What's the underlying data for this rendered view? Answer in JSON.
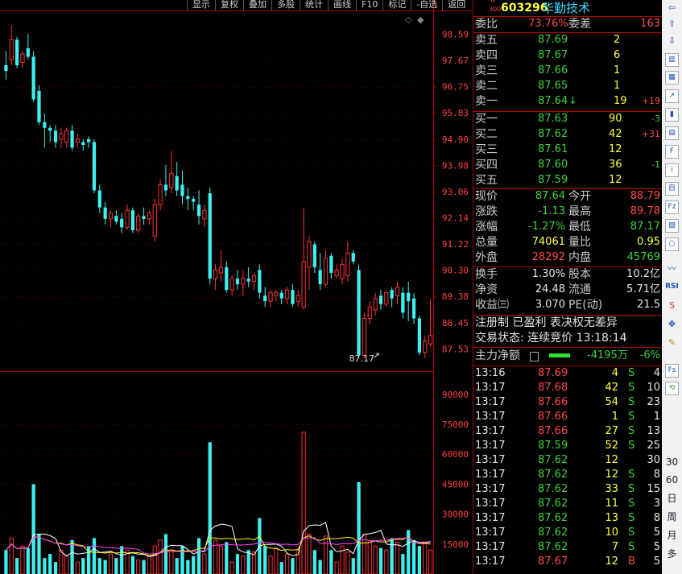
{
  "toolbar": [
    "显示",
    "复权",
    "叠加",
    "多股",
    "统计",
    "画线",
    "F10",
    "标记",
    "-自选",
    "返回"
  ],
  "chart_data": [
    {
      "type": "candlestick",
      "title": "",
      "price_axis": [
        "98.59",
        "97.67",
        "96.75",
        "95.83",
        "94.90",
        "93.98",
        "93.06",
        "92.14",
        "91.22",
        "90.30",
        "89.38",
        "88.45",
        "87.53"
      ],
      "ylim": [
        87.0,
        99.2
      ],
      "low_marker": "87.17",
      "up_color": "#ff3030",
      "down_color": "#3ef0f0",
      "candles": [
        {
          "o": 97.5,
          "h": 98.0,
          "l": 97.0,
          "c": 97.3
        },
        {
          "o": 97.7,
          "h": 98.9,
          "l": 97.5,
          "c": 98.4
        },
        {
          "o": 98.4,
          "h": 98.5,
          "l": 97.4,
          "c": 97.5
        },
        {
          "o": 97.6,
          "h": 98.0,
          "l": 97.4,
          "c": 97.9
        },
        {
          "o": 98.1,
          "h": 98.6,
          "l": 97.7,
          "c": 97.8
        },
        {
          "o": 97.8,
          "h": 98.0,
          "l": 96.2,
          "c": 96.3
        },
        {
          "o": 96.6,
          "h": 96.8,
          "l": 95.4,
          "c": 95.5
        },
        {
          "o": 95.5,
          "h": 95.8,
          "l": 94.6,
          "c": 95.3
        },
        {
          "o": 95.3,
          "h": 95.4,
          "l": 94.8,
          "c": 95.2
        },
        {
          "o": 95.2,
          "h": 95.4,
          "l": 94.6,
          "c": 94.8
        },
        {
          "o": 94.9,
          "h": 95.3,
          "l": 94.6,
          "c": 95.1
        },
        {
          "o": 94.8,
          "h": 95.3,
          "l": 94.6,
          "c": 95.2
        },
        {
          "o": 95.2,
          "h": 95.4,
          "l": 94.5,
          "c": 94.6
        },
        {
          "o": 94.8,
          "h": 95.1,
          "l": 94.6,
          "c": 94.9
        },
        {
          "o": 94.8,
          "h": 94.9,
          "l": 94.5,
          "c": 94.7
        },
        {
          "o": 94.9,
          "h": 95.0,
          "l": 94.6,
          "c": 94.8
        },
        {
          "o": 94.8,
          "h": 94.9,
          "l": 93.0,
          "c": 93.1
        },
        {
          "o": 93.1,
          "h": 93.3,
          "l": 92.3,
          "c": 92.5
        },
        {
          "o": 92.5,
          "h": 92.7,
          "l": 91.9,
          "c": 92.1
        },
        {
          "o": 92.1,
          "h": 92.4,
          "l": 91.8,
          "c": 92.3
        },
        {
          "o": 92.2,
          "h": 92.4,
          "l": 91.9,
          "c": 92.0
        },
        {
          "o": 92.1,
          "h": 92.3,
          "l": 91.6,
          "c": 91.8
        },
        {
          "o": 91.8,
          "h": 92.6,
          "l": 91.7,
          "c": 92.4
        },
        {
          "o": 92.4,
          "h": 92.5,
          "l": 91.6,
          "c": 91.7
        },
        {
          "o": 91.7,
          "h": 92.3,
          "l": 91.6,
          "c": 92.2
        },
        {
          "o": 92.2,
          "h": 92.5,
          "l": 91.9,
          "c": 92.1
        },
        {
          "o": 92.1,
          "h": 92.4,
          "l": 91.9,
          "c": 92.3
        },
        {
          "o": 91.5,
          "h": 92.8,
          "l": 91.3,
          "c": 92.6
        },
        {
          "o": 92.6,
          "h": 93.5,
          "l": 92.4,
          "c": 93.3
        },
        {
          "o": 93.3,
          "h": 94.0,
          "l": 92.9,
          "c": 93.1
        },
        {
          "o": 93.2,
          "h": 94.5,
          "l": 93.0,
          "c": 93.7
        },
        {
          "o": 93.6,
          "h": 94.1,
          "l": 92.9,
          "c": 93.1
        },
        {
          "o": 93.3,
          "h": 93.8,
          "l": 92.6,
          "c": 92.9
        },
        {
          "o": 92.9,
          "h": 93.2,
          "l": 92.4,
          "c": 92.8
        },
        {
          "o": 92.8,
          "h": 92.9,
          "l": 92.4,
          "c": 92.7
        },
        {
          "o": 92.6,
          "h": 93.1,
          "l": 91.9,
          "c": 92.2
        },
        {
          "o": 92.1,
          "h": 92.6,
          "l": 91.8,
          "c": 92.4
        },
        {
          "o": 93.0,
          "h": 93.2,
          "l": 89.8,
          "c": 90.0
        },
        {
          "o": 90.0,
          "h": 90.5,
          "l": 89.6,
          "c": 90.3
        },
        {
          "o": 90.2,
          "h": 91.0,
          "l": 89.9,
          "c": 90.4
        },
        {
          "o": 90.4,
          "h": 90.6,
          "l": 89.5,
          "c": 89.6
        },
        {
          "o": 89.6,
          "h": 90.1,
          "l": 89.4,
          "c": 90.0
        },
        {
          "o": 90.0,
          "h": 90.3,
          "l": 89.6,
          "c": 89.8
        },
        {
          "o": 89.8,
          "h": 90.3,
          "l": 89.4,
          "c": 90.0
        },
        {
          "o": 90.0,
          "h": 90.4,
          "l": 89.7,
          "c": 89.9
        },
        {
          "o": 89.9,
          "h": 90.2,
          "l": 89.6,
          "c": 90.1
        },
        {
          "o": 90.3,
          "h": 90.5,
          "l": 89.3,
          "c": 89.5
        },
        {
          "o": 89.4,
          "h": 89.7,
          "l": 89.0,
          "c": 89.2
        },
        {
          "o": 89.2,
          "h": 89.6,
          "l": 89.0,
          "c": 89.5
        },
        {
          "o": 89.4,
          "h": 89.6,
          "l": 89.2,
          "c": 89.5
        },
        {
          "o": 89.5,
          "h": 89.6,
          "l": 89.1,
          "c": 89.3
        },
        {
          "o": 89.3,
          "h": 89.7,
          "l": 89.1,
          "c": 89.6
        },
        {
          "o": 89.6,
          "h": 89.8,
          "l": 89.0,
          "c": 89.1
        },
        {
          "o": 89.2,
          "h": 89.6,
          "l": 89.0,
          "c": 89.4
        },
        {
          "o": 89.0,
          "h": 92.5,
          "l": 88.9,
          "c": 90.6
        },
        {
          "o": 90.4,
          "h": 91.5,
          "l": 89.6,
          "c": 91.3
        },
        {
          "o": 91.2,
          "h": 91.3,
          "l": 90.2,
          "c": 90.4
        },
        {
          "o": 90.3,
          "h": 90.9,
          "l": 89.6,
          "c": 89.8
        },
        {
          "o": 89.8,
          "h": 91.0,
          "l": 89.7,
          "c": 90.7
        },
        {
          "o": 90.8,
          "h": 90.9,
          "l": 90.0,
          "c": 90.2
        },
        {
          "o": 90.1,
          "h": 90.5,
          "l": 90.0,
          "c": 90.3
        },
        {
          "o": 90.0,
          "h": 90.7,
          "l": 89.8,
          "c": 90.5
        },
        {
          "o": 90.1,
          "h": 91.3,
          "l": 89.9,
          "c": 90.9
        },
        {
          "o": 90.9,
          "h": 91.0,
          "l": 90.5,
          "c": 90.6
        },
        {
          "o": 90.3,
          "h": 90.5,
          "l": 87.2,
          "c": 87.3
        },
        {
          "o": 87.3,
          "h": 88.8,
          "l": 87.2,
          "c": 88.6
        },
        {
          "o": 88.6,
          "h": 89.2,
          "l": 88.4,
          "c": 89.0
        },
        {
          "o": 88.9,
          "h": 89.5,
          "l": 88.7,
          "c": 89.3
        },
        {
          "o": 89.4,
          "h": 89.6,
          "l": 88.9,
          "c": 89.1
        },
        {
          "o": 89.1,
          "h": 89.6,
          "l": 89.0,
          "c": 89.5
        },
        {
          "o": 89.6,
          "h": 89.7,
          "l": 89.0,
          "c": 89.3
        },
        {
          "o": 89.4,
          "h": 89.9,
          "l": 89.1,
          "c": 89.7
        },
        {
          "o": 89.5,
          "h": 89.7,
          "l": 88.6,
          "c": 88.8
        },
        {
          "o": 89.5,
          "h": 89.9,
          "l": 88.5,
          "c": 89.2
        },
        {
          "o": 89.3,
          "h": 89.5,
          "l": 88.4,
          "c": 88.6
        },
        {
          "o": 88.6,
          "h": 88.7,
          "l": 87.3,
          "c": 87.4
        },
        {
          "o": 87.4,
          "h": 88.0,
          "l": 87.2,
          "c": 87.8
        },
        {
          "o": 87.7,
          "h": 89.3,
          "l": 87.6,
          "c": 88.0
        }
      ]
    },
    {
      "type": "bar",
      "title": "volume",
      "volume_axis": [
        "90000",
        "75000",
        "60000",
        "45000",
        "30000",
        "15000"
      ],
      "ylim": [
        0,
        98000
      ],
      "values": [
        12000,
        18000,
        8000,
        14000,
        13000,
        45000,
        20000,
        8000,
        10000,
        6000,
        12000,
        9000,
        17000,
        6000,
        8000,
        14000,
        18000,
        8000,
        7000,
        10000,
        8000,
        14000,
        12000,
        9000,
        7000,
        7000,
        9000,
        14000,
        17000,
        20000,
        12000,
        8000,
        14000,
        7000,
        9000,
        18000,
        10000,
        66000,
        17000,
        14000,
        16000,
        6000,
        10000,
        9000,
        12000,
        11000,
        28000,
        14000,
        9000,
        13000,
        6000,
        10000,
        8000,
        12000,
        71000,
        20000,
        12000,
        7000,
        19000,
        12000,
        6000,
        14000,
        11000,
        8000,
        46000,
        20000,
        16000,
        14000,
        13000,
        12000,
        18000,
        16000,
        10000,
        22000,
        17000,
        14000,
        16000,
        12000
      ],
      "ma_lines": [
        {
          "name": "MA5",
          "color": "#ffffff"
        },
        {
          "name": "MA10",
          "color": "#ffff00"
        },
        {
          "name": "MA20",
          "color": "#ff40ff"
        }
      ]
    }
  ],
  "stock": {
    "board": "R",
    "board_sub": "300",
    "code": "603296",
    "name": "华勤技术"
  },
  "weibi": {
    "label1": "委比",
    "val1": "73.76%",
    "label2": "委差",
    "val2": "163"
  },
  "sell": [
    {
      "label": "卖五",
      "price": "87.69",
      "vol": "2",
      "chg": ""
    },
    {
      "label": "卖四",
      "price": "87.67",
      "vol": "6",
      "chg": ""
    },
    {
      "label": "卖三",
      "price": "87.66",
      "vol": "1",
      "chg": ""
    },
    {
      "label": "卖二",
      "price": "87.65",
      "vol": "1",
      "chg": ""
    },
    {
      "label": "卖一",
      "price": "87.64",
      "arrow": "↓",
      "vol": "19",
      "chg": "+19"
    }
  ],
  "buy": [
    {
      "label": "买一",
      "price": "87.63",
      "vol": "90",
      "chg": "-3"
    },
    {
      "label": "买二",
      "price": "87.62",
      "vol": "42",
      "chg": "+31"
    },
    {
      "label": "买三",
      "price": "87.61",
      "vol": "12",
      "chg": ""
    },
    {
      "label": "买四",
      "price": "87.60",
      "vol": "36",
      "chg": "-1"
    },
    {
      "label": "买五",
      "price": "87.59",
      "vol": "12",
      "chg": ""
    }
  ],
  "quote": [
    {
      "l1": "现价",
      "v1": "87.64",
      "l2": "今开",
      "v2": "88.79"
    },
    {
      "l1": "涨跌",
      "v1": "-1.13",
      "l2": "最高",
      "v2": "89.78"
    },
    {
      "l1": "涨幅",
      "v1": "-1.27%",
      "l2": "最低",
      "v2": "87.17"
    },
    {
      "l1": "总量",
      "v1": "74061",
      "l2": "量比",
      "v2": "0.95"
    },
    {
      "l1": "外盘",
      "v1": "28292",
      "l2": "内盘",
      "v2": "45769"
    }
  ],
  "stats": [
    {
      "l1": "换手",
      "v1": "1.30%",
      "l2": "股本",
      "v2": "10.2亿"
    },
    {
      "l1": "净资",
      "v1": "24.48",
      "l2": "流通",
      "v2": "5.71亿"
    },
    {
      "l1": "收益㈢",
      "v1": "3.070",
      "l2": "PE(动)",
      "v2": "21.5"
    }
  ],
  "notes": {
    "reg": "注册制 已盈利 表决权无差异",
    "status": "交易状态: 连续竞价 13:18:14"
  },
  "main_flow": {
    "label": "主力净额",
    "value": "-4195万",
    "pct": "-6%"
  },
  "ticks": [
    {
      "t": "13:16",
      "p": "87.69",
      "v": "4",
      "s": "S",
      "n": "4"
    },
    {
      "t": "13:17",
      "p": "87.68",
      "v": "42",
      "s": "S",
      "n": "10"
    },
    {
      "t": "13:17",
      "p": "87.66",
      "v": "54",
      "s": "S",
      "n": "23"
    },
    {
      "t": "13:17",
      "p": "87.66",
      "v": "1",
      "s": "S",
      "n": "1"
    },
    {
      "t": "13:17",
      "p": "87.66",
      "v": "27",
      "s": "S",
      "n": "13"
    },
    {
      "t": "13:17",
      "p": "87.59",
      "v": "52",
      "s": "S",
      "n": "25"
    },
    {
      "t": "13:17",
      "p": "87.62",
      "v": "12",
      "s": "",
      "n": "30"
    },
    {
      "t": "13:17",
      "p": "87.62",
      "v": "12",
      "s": "S",
      "n": "8"
    },
    {
      "t": "13:17",
      "p": "87.62",
      "v": "33",
      "s": "S",
      "n": "15"
    },
    {
      "t": "13:17",
      "p": "87.62",
      "v": "11",
      "s": "S",
      "n": "3"
    },
    {
      "t": "13:17",
      "p": "87.62",
      "v": "13",
      "s": "S",
      "n": "8"
    },
    {
      "t": "13:17",
      "p": "87.62",
      "v": "10",
      "s": "S",
      "n": "5"
    },
    {
      "t": "13:17",
      "p": "87.62",
      "v": "7",
      "s": "S",
      "n": "5"
    },
    {
      "t": "13:17",
      "p": "87.67",
      "v": "12",
      "s": "B",
      "n": "5"
    }
  ],
  "right_toolbar": [
    "30",
    "60",
    "日",
    "周",
    "月",
    "多"
  ]
}
